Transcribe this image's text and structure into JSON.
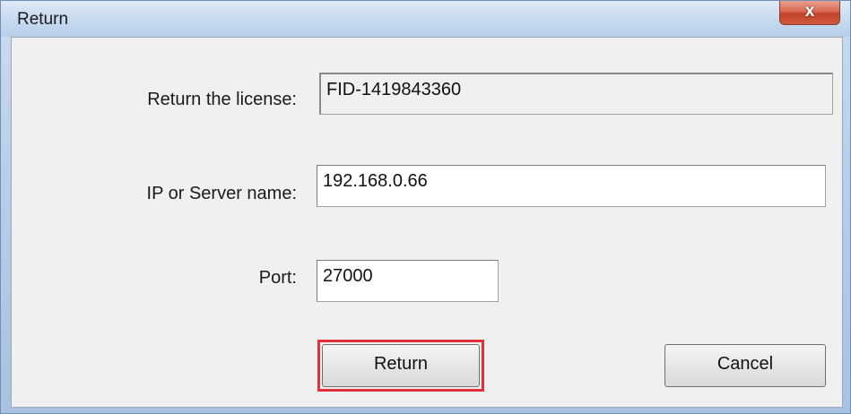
{
  "window": {
    "title": "Return",
    "close_glyph": "x"
  },
  "form": {
    "license_label": "Return the license:",
    "license_value": "FID-1419843360",
    "server_label": "IP or Server name:",
    "server_value": "192.168.0.66",
    "port_label": "Port:",
    "port_value": "27000"
  },
  "buttons": {
    "return_label": "Return",
    "cancel_label": "Cancel"
  },
  "colors": {
    "highlight": "#e0303a",
    "close_button": "#c34229"
  }
}
